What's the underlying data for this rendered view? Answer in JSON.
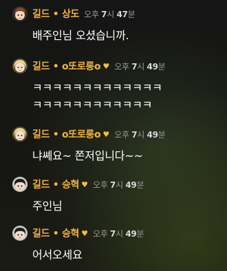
{
  "messages": [
    {
      "avatar": "character-avatar-brown-hair",
      "name": "길드 • 상도",
      "heart": "",
      "time": {
        "period": "오후",
        "hour": "7",
        "hour_unit": "시",
        "minute": "47",
        "minute_unit": "분"
      },
      "lines": [
        "배주인님 오셨습니까."
      ]
    },
    {
      "avatar": "character-avatar-blonde-hair",
      "name": "길드 • o또로롱o",
      "heart": "♥",
      "time": {
        "period": "오후",
        "hour": "7",
        "hour_unit": "시",
        "minute": "49",
        "minute_unit": "분"
      },
      "lines": [
        "ㅋㅋㅋㅋㅋㅋㅋㅋㅋㅋㅋㅋㅋ",
        "ㅋㅋㅋㅋㅋㅋㅋㅋㅋㅋㅋㅋ"
      ]
    },
    {
      "avatar": "character-avatar-blonde-hair",
      "name": "길드 • o또로롱o",
      "heart": "♥",
      "time": {
        "period": "오후",
        "hour": "7",
        "hour_unit": "시",
        "minute": "49",
        "minute_unit": "분"
      },
      "lines": [
        "냐쎼요~ 쫀저입니다~~"
      ]
    },
    {
      "avatar": "character-avatar-dark-hair",
      "name": "길드 • 승혁",
      "heart": "♥",
      "time": {
        "period": "오후",
        "hour": "7",
        "hour_unit": "시",
        "minute": "49",
        "minute_unit": "분"
      },
      "lines": [
        "주인님"
      ]
    },
    {
      "avatar": "character-avatar-dark-hair",
      "name": "길드 • 승혁",
      "heart": "♥",
      "time": {
        "period": "오후",
        "hour": "7",
        "hour_unit": "시",
        "minute": "49",
        "minute_unit": "분"
      },
      "lines": [
        "어서오세요"
      ]
    }
  ],
  "colors": {
    "name": "#f0b43c",
    "heart": "#f2c230",
    "time": "#9a9a9a",
    "text": "#ffffff"
  }
}
